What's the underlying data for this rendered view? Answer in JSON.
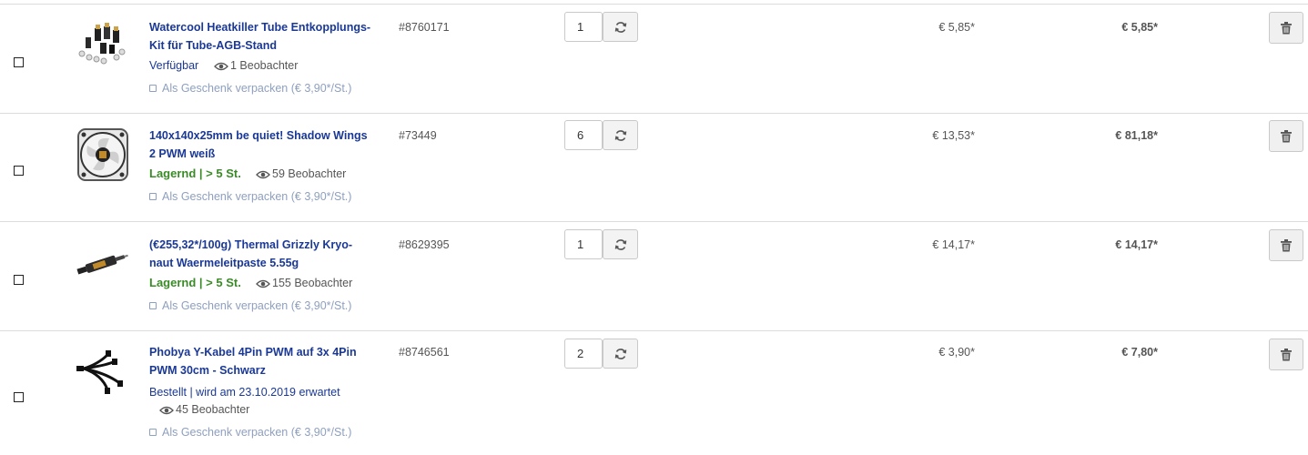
{
  "colors": {
    "title": "#1a3896",
    "stock_green": "#3a8b27",
    "gift": "#8ea0bf",
    "border": "#dcdcdc"
  },
  "items": [
    {
      "title_line1": "Watercool Heatkiller Tube Entkopplungs-",
      "title_line2": "Kit für Tube-AGB-Stand",
      "sku": "#8760171",
      "status": "Verfügbar",
      "status_line2": "",
      "watchers": "1 Beobachter",
      "gift": "Als Geschenk verpacken (€ 3,90*/St.)",
      "qty": "1",
      "unit_price": "€ 5,85*",
      "total_price": "€ 5,85*"
    },
    {
      "title_line1": "140x140x25mm be quiet! Shadow Wings",
      "title_line2": "2 PWM weiß",
      "sku": "#73449",
      "status": "Lagernd | > 5 St.",
      "status_line2": "",
      "watchers": "59 Beobachter",
      "gift": "Als Geschenk verpacken (€ 3,90*/St.)",
      "qty": "6",
      "unit_price": "€ 13,53*",
      "total_price": "€ 81,18*"
    },
    {
      "title_line1": "(€255,32*/100g) Thermal Grizzly Kryo-",
      "title_line2": "naut Waermeleitpaste 5.55g",
      "sku": "#8629395",
      "status": "Lagernd | > 5 St.",
      "status_line2": "",
      "watchers": "155 Beobachter",
      "gift": "Als Geschenk verpacken (€ 3,90*/St.)",
      "qty": "1",
      "unit_price": "€ 14,17*",
      "total_price": "€ 14,17*"
    },
    {
      "title_line1": "Phobya Y-Kabel 4Pin PWM auf 3x 4Pin",
      "title_line2": "PWM 30cm - Schwarz",
      "sku": "#8746561",
      "status": "Bestellt | wird am 23.10.2019 erwartet",
      "status_line2": "",
      "watchers": "45 Beobachter",
      "gift": "Als Geschenk verpacken (€ 3,90*/St.)",
      "qty": "2",
      "unit_price": "€ 3,90*",
      "total_price": "€ 7,80*"
    }
  ]
}
